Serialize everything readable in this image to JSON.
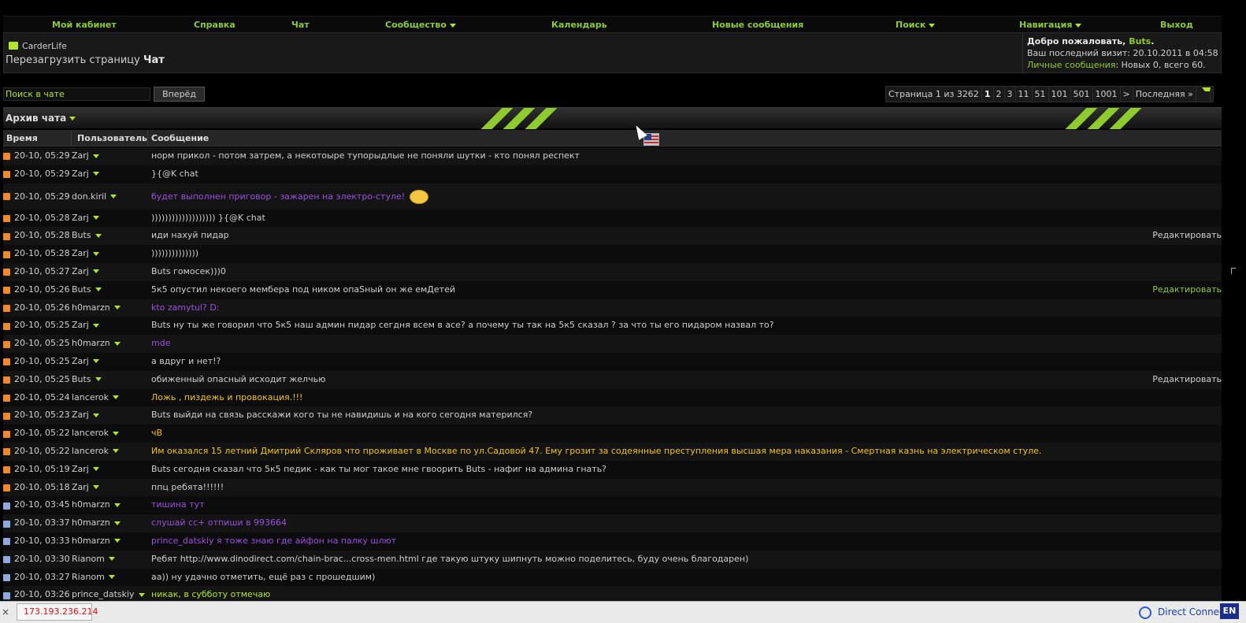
{
  "topnav": [
    {
      "label": "Мой кабинет",
      "dropdown": false
    },
    {
      "label": "Справка",
      "dropdown": false
    },
    {
      "label": "Чат",
      "dropdown": false
    },
    {
      "label": "Сообщество",
      "dropdown": true
    },
    {
      "label": "Календарь",
      "dropdown": false
    },
    {
      "label": "Новые сообщения",
      "dropdown": false
    },
    {
      "label": "Поиск",
      "dropdown": true
    },
    {
      "label": "Навигация",
      "dropdown": true
    },
    {
      "label": "Выход",
      "dropdown": false
    }
  ],
  "breadcrumb": {
    "site": "CarderLife",
    "reload_prefix": "Перезагрузить страницу",
    "current": "Чат"
  },
  "welcome": {
    "greeting": "Добро пожаловать,",
    "username": "Buts",
    "greeting_end": ".",
    "last_visit_label": "Ваш последний визит:",
    "last_visit_value": "20.10.2011 в 04:58",
    "pm_label": "Личные сообщения",
    "pm_value": ": Новых 0, всего 60."
  },
  "search": {
    "placeholder": "Поиск в чате",
    "button": "Вперёд"
  },
  "pager": {
    "label": "Страница 1 из 3262",
    "pages": [
      "1",
      "2",
      "3",
      "11",
      "51",
      "101",
      "501",
      "1001",
      ">"
    ],
    "current": "1",
    "last": "Последняя »"
  },
  "archive": {
    "title": "Архив чата"
  },
  "columns": {
    "time": "Время",
    "user": "Пользователь",
    "message": "Сообщение"
  },
  "messages": [
    {
      "time": "20-10, 05:29",
      "user": "Zarj",
      "text": "норм прикол - потом затрем, а некотоыре тупорыдлые не поняли шутки - кто понял респект",
      "color": "#cfcfcf",
      "icon": "#f08a28",
      "edit": ""
    },
    {
      "time": "20-10, 05:29",
      "user": "Zarj",
      "text": "}{@K chat",
      "color": "#cfcfcf",
      "icon": "#f08a28",
      "edit": ""
    },
    {
      "time": "20-10, 05:29",
      "user": "don.kiril",
      "text": "будет выполнен приговор - зажарен на электро-стуле!",
      "color": "#9c4fe0",
      "icon": "#f08a28",
      "edit": "",
      "smiley": true
    },
    {
      "time": "20-10, 05:28",
      "user": "Zarj",
      "text": "))))))))))))))))))) }{@K chat",
      "color": "#cfcfcf",
      "icon": "#f08a28",
      "edit": ""
    },
    {
      "time": "20-10, 05:28",
      "user": "Buts",
      "text": "иди нахуй пидар",
      "color": "#cfcfcf",
      "icon": "#f08a28",
      "edit": "Редактировать"
    },
    {
      "time": "20-10, 05:28",
      "user": "Zarj",
      "text": "))))))))))))))",
      "color": "#cfcfcf",
      "icon": "#f08a28",
      "edit": ""
    },
    {
      "time": "20-10, 05:27",
      "user": "Zarj",
      "text": "Buts гомосек)))0",
      "color": "#cfcfcf",
      "icon": "#f08a28",
      "edit": ""
    },
    {
      "time": "20-10, 05:26",
      "user": "Buts",
      "text": "5к5 опустил некоего мембера под ником опаSный он же емДетей",
      "color": "#cfcfcf",
      "icon": "#f08a28",
      "edit": "Редактировать",
      "edit_green": true
    },
    {
      "time": "20-10, 05:26",
      "user": "h0marzn",
      "text": "kto zamytul? D:",
      "color": "#9c4fe0",
      "icon": "#f08a28",
      "edit": ""
    },
    {
      "time": "20-10, 05:25",
      "user": "Zarj",
      "text": "Buts ну ты же говорил что 5к5 наш админ пидар сегдня всем в асе? а почему ты так на 5к5 сказал ? за что ты его пидаром назвал то?",
      "color": "#cfcfcf",
      "icon": "#f08a28",
      "edit": ""
    },
    {
      "time": "20-10, 05:25",
      "user": "h0marzn",
      "text": "mde",
      "color": "#9c4fe0",
      "icon": "#f08a28",
      "edit": ""
    },
    {
      "time": "20-10, 05:25",
      "user": "Zarj",
      "text": "а вдруг и нет!?",
      "color": "#cfcfcf",
      "icon": "#f08a28",
      "edit": ""
    },
    {
      "time": "20-10, 05:25",
      "user": "Buts",
      "text": "обиженный опасный исходит желчью",
      "color": "#cfcfcf",
      "icon": "#f08a28",
      "edit": "Редактировать"
    },
    {
      "time": "20-10, 05:24",
      "user": "lancerok",
      "text": "Ложь , пиздежь и провокация.!!!",
      "color": "#f2c41a",
      "icon": "#f08a28",
      "edit": ""
    },
    {
      "time": "20-10, 05:23",
      "user": "Zarj",
      "text": "Buts выйди на связь расскажи кого ты не навидишь и на кого сегодня матерился?",
      "color": "#cfcfcf",
      "icon": "#f08a28",
      "edit": ""
    },
    {
      "time": "20-10, 05:22",
      "user": "lancerok",
      "text": "чВ",
      "color": "#f2c41a",
      "icon": "#f08a28",
      "edit": ""
    },
    {
      "time": "20-10, 05:22",
      "user": "lancerok",
      "text": "Им оказался 15 летний Дмитрий Скляров что проживает в Москве по ул.Садовой 47. Ему грозит за содеянные преступления высшая мера наказания - Смертная казнь на электрическом стуле.",
      "color": "#f2c41a",
      "icon": "#f08a28",
      "edit": ""
    },
    {
      "time": "20-10, 05:19",
      "user": "Zarj",
      "text": "Buts сегодня сказал что 5к5 педик - как ты мог такое мне гвоорить Buts - нафиг на админа гнать?",
      "color": "#cfcfcf",
      "icon": "#f08a28",
      "edit": ""
    },
    {
      "time": "20-10, 05:18",
      "user": "Zarj",
      "text": "ппц ребята!!!!!!",
      "color": "#cfcfcf",
      "icon": "#f08a28",
      "edit": ""
    },
    {
      "time": "20-10, 03:45",
      "user": "h0marzn",
      "text": "тишина тут",
      "color": "#9c4fe0",
      "icon": "#8fa8e0",
      "edit": ""
    },
    {
      "time": "20-10, 03:37",
      "user": "h0marzn",
      "text": "слушай сс+ отпиши в 993664",
      "color": "#9c4fe0",
      "icon": "#8fa8e0",
      "edit": ""
    },
    {
      "time": "20-10, 03:33",
      "user": "h0marzn",
      "text": "prince_datskiy я тоже знаю где айфон на палку шлют",
      "color": "#9c4fe0",
      "icon": "#8fa8e0",
      "edit": ""
    },
    {
      "time": "20-10, 03:30",
      "user": "Rianom",
      "text": "Ребят http://www.dinodirect.com/chain-brac...cross-men.html где такую штуку шипнуть можно поделитесь, буду очень благодарен)",
      "color": "#cfcfcf",
      "icon": "#8fa8e0",
      "edit": ""
    },
    {
      "time": "20-10, 03:27",
      "user": "Rianom",
      "text": "аа)) ну удачно отметить, ещё раз с прошедшим)",
      "color": "#cfcfcf",
      "icon": "#8fa8e0",
      "edit": ""
    },
    {
      "time": "20-10, 03:26",
      "user": "prince_datskiy",
      "text": "никак, в субботу отмечаю",
      "color": "#b2e52a",
      "icon": "#8fa8e0",
      "edit": ""
    }
  ],
  "statusbar": {
    "close": "×",
    "ip": "173.193.236.214",
    "dc": "Direct Connec",
    "lang": "EN"
  }
}
